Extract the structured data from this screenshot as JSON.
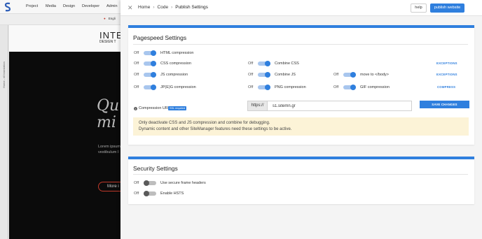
{
  "background": {
    "nav": [
      "Project",
      "Media",
      "Design",
      "Developer",
      "Admin"
    ],
    "lang": "Engli",
    "vertical_text": "Home - ell translation",
    "hero_title": "INTE",
    "hero_sub": "DESIGN T",
    "hero_script_line1": "Qu",
    "hero_script_line2": "mi",
    "hero_lorem_line1": "Lorem ipsum",
    "hero_lorem_line2": "vestibulum l",
    "hero_button": "More i"
  },
  "header": {
    "breadcrumb": [
      "Home",
      "Code",
      "Publish Settings"
    ],
    "separator": "›",
    "help_label": "help",
    "publish_label": "publish website"
  },
  "pagespeed": {
    "title": "Pagespeed Settings",
    "settings": {
      "html": {
        "off": "Off",
        "label": "HTML compression",
        "on": true
      },
      "css": {
        "off": "Off",
        "label": "CSS compression",
        "on": true
      },
      "js": {
        "off": "Off",
        "label": "JS compression",
        "on": true
      },
      "jpeg": {
        "off": "Off",
        "label": "JP(E)G compression",
        "on": true
      },
      "combine_css": {
        "off": "Off",
        "label": "Combine CSS",
        "on": true
      },
      "combine_js": {
        "off": "Off",
        "label": "Combine JS",
        "on": true
      },
      "png": {
        "off": "Off",
        "label": "PNG compression",
        "on": true
      },
      "move_body": {
        "off": "Off",
        "label": "move to </body>",
        "on": true
      },
      "gif": {
        "off": "Off",
        "label": "GIF compression",
        "on": true
      }
    },
    "exceptions_css": "EXCEPTIONS",
    "exceptions_js": "EXCEPTIONS",
    "compress_link": "COMPRESS",
    "compression_url_label": "Compression URL",
    "ssl_badge": "SSL required",
    "url_prefix": "https://",
    "url_value": "s1.sitemn.gr",
    "save_label": "SAVE CHANGES",
    "notice_line1": "Only deactivate CSS and JS compression and combine for debugging.",
    "notice_line2": "Dynamic content and other SiteManager features need these settings to be active."
  },
  "security": {
    "title": "Security Settings",
    "frame_headers": {
      "off": "Off",
      "label": "Use secure frame headers",
      "on": false
    },
    "hsts": {
      "off": "Off",
      "label": "Enable HSTS",
      "on": false
    }
  },
  "colors": {
    "accent": "#2f7fde",
    "notice_bg": "#fcf3d7"
  }
}
